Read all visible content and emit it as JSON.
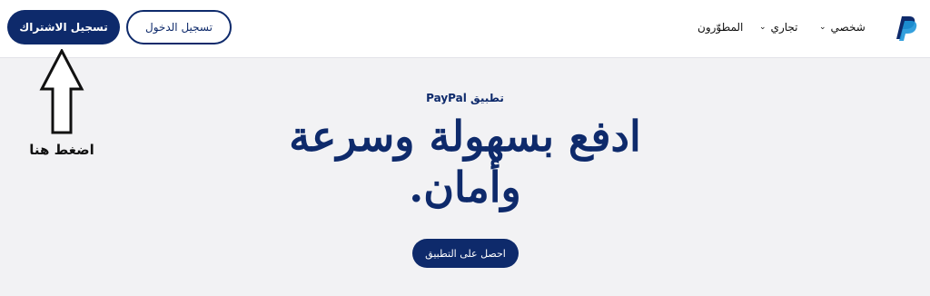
{
  "header": {
    "signup_label": "تسجيل الاشتراك",
    "login_label": "تسجيل الدخول",
    "nav": {
      "personal": "شخصي",
      "business": "تجاري",
      "developers": "المطوّرون"
    }
  },
  "annotation": {
    "click_here": "اضغط هنا"
  },
  "hero": {
    "kicker": "تطبيق PayPal",
    "headline": "ادفع بسهولة وسرعة وأمان.",
    "cta_label": "احصل على التطبيق"
  },
  "colors": {
    "brand_dark": "#0e2a6b",
    "brand_light": "#1e96d9",
    "background": "#f2f2f4"
  },
  "icons": {
    "logo": "paypal-logo",
    "nav_chevron": "chevron-down-icon",
    "annotation_arrow": "up-arrow-icon"
  }
}
